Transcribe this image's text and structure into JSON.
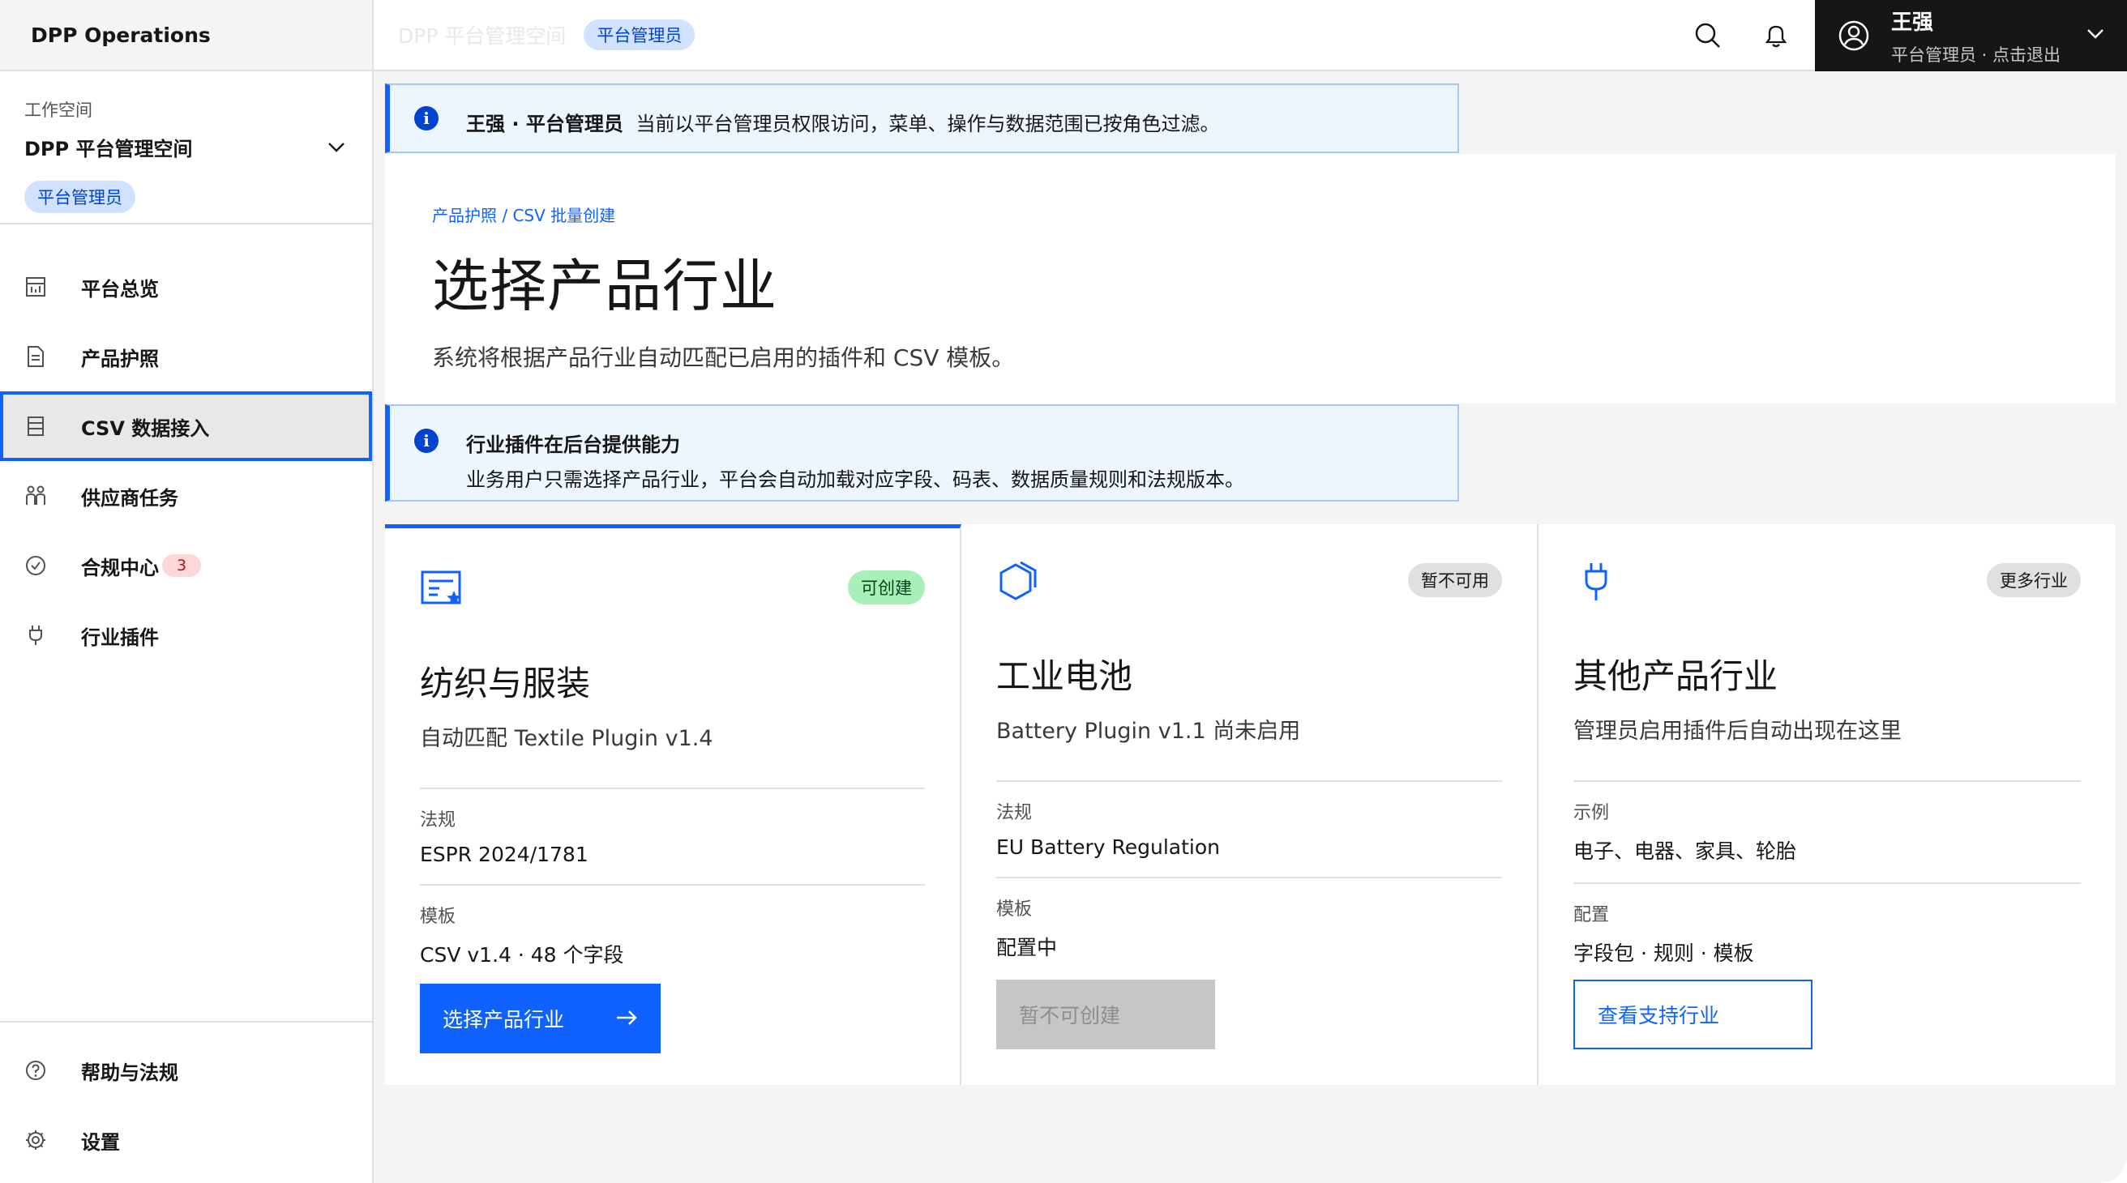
{
  "app": {
    "brand": "DPP Operations"
  },
  "workspace": {
    "label": "工作空间",
    "name": "DPP 平台管理空间",
    "role": "平台管理员"
  },
  "nav": {
    "items": [
      {
        "label": "平台总览",
        "icon": "dashboard-icon"
      },
      {
        "label": "产品护照",
        "icon": "document-icon"
      },
      {
        "label": "CSV 数据接入",
        "icon": "data-table-icon",
        "active": true
      },
      {
        "label": "供应商任务",
        "icon": "people-icon"
      },
      {
        "label": "合规中心",
        "icon": "checkmark-circle-icon",
        "badge": "3"
      },
      {
        "label": "行业插件",
        "icon": "plug-icon"
      }
    ],
    "bottom": [
      {
        "label": "帮助与法规",
        "icon": "help-icon"
      },
      {
        "label": "设置",
        "icon": "gear-icon"
      }
    ]
  },
  "header": {
    "title": "DPP 平台管理空间",
    "role_tag": "平台管理员",
    "user_name": "王强",
    "user_sub": "平台管理员 · 点击退出"
  },
  "notice_role": {
    "bold": "王强 · 平台管理员",
    "text": "当前以平台管理员权限访问，菜单、操作与数据范围已按角色过滤。"
  },
  "page": {
    "breadcrumb": "产品护照 / CSV 批量创建",
    "title": "选择产品行业",
    "description": "系统将根据产品行业自动匹配已启用的插件和 CSV 模板。"
  },
  "notice_plugin": {
    "title": "行业插件在后台提供能力",
    "text": "业务用户只需选择产品行业，平台会自动加载对应字段、码表、数据质量规则和法规版本。"
  },
  "cards": [
    {
      "tag": "可创建",
      "title": "纺织与服装",
      "subtitle": "自动匹配 Textile Plugin v1.4",
      "field1_label": "法规",
      "field1_value": "ESPR 2024/1781",
      "field2_label": "模板",
      "field2_value": "CSV v1.4 · 48 个字段",
      "button": "选择产品行业"
    },
    {
      "tag": "暂不可用",
      "title": "工业电池",
      "subtitle": "Battery Plugin v1.1 尚未启用",
      "field1_label": "法规",
      "field1_value": "EU Battery Regulation",
      "field2_label": "模板",
      "field2_value": "配置中",
      "button": "暂不可创建"
    },
    {
      "tag": "更多行业",
      "title": "其他产品行业",
      "subtitle": "管理员启用插件后自动出现在这里",
      "field1_label": "示例",
      "field1_value": "电子、电器、家具、轮胎",
      "field2_label": "配置",
      "field2_value": "字段包 · 规则 · 模板",
      "button": "查看支持行业"
    }
  ],
  "colors": {
    "accent": "#0f62fe",
    "sidebar_bg": "#ffffff",
    "page_bg": "#f4f4f4",
    "tag_green": "#a7f0ba",
    "badge_red": "#ffd7d9"
  }
}
